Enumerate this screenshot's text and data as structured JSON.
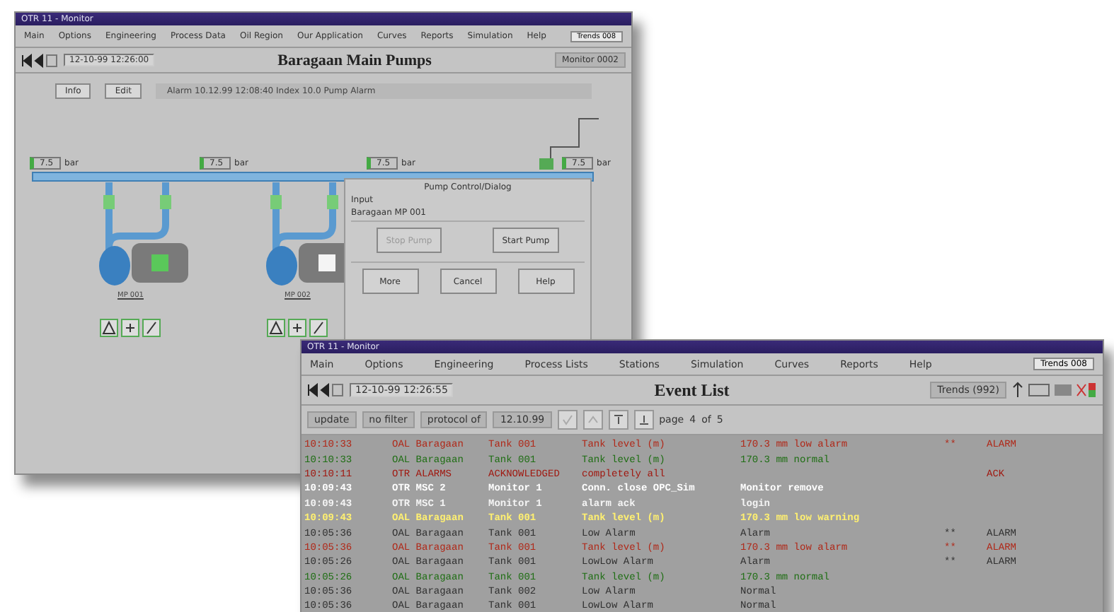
{
  "main_window": {
    "title": "OTR 11 - Monitor",
    "menu": [
      "Main",
      "Options",
      "Engineering",
      "Process Data",
      "Oil Region",
      "Our Application",
      "Curves",
      "Reports",
      "Simulation",
      "Help"
    ],
    "menu_button": "Trends 008",
    "timestamp": "12-10-99 12:26:00",
    "heading": "Baragaan Main Pumps",
    "monitor": "Monitor 0002",
    "status_buttons": [
      "Info",
      "Edit"
    ],
    "status_text": "Alarm 10.12.99 12:08:40 Index 10.0 Pump Alarm",
    "pressure_labels": [
      {
        "value": "7.5",
        "unit": "bar"
      },
      {
        "value": "7.5",
        "unit": "bar"
      },
      {
        "value": "7.5",
        "unit": "bar"
      },
      {
        "value": "7.5",
        "unit": "bar"
      }
    ],
    "pumps": [
      {
        "label": "MP 001",
        "running": true
      },
      {
        "label": "MP 002",
        "running": false
      }
    ],
    "dialog": {
      "title": "Pump Control/Dialog",
      "lines": [
        "Input",
        "Baragaan MP 001"
      ],
      "buttons": [
        {
          "label": "Stop Pump",
          "disabled": true
        },
        {
          "label": "Start Pump",
          "disabled": false
        },
        {
          "label": "More",
          "disabled": false
        },
        {
          "label": "Cancel",
          "disabled": false
        },
        {
          "label": "Help",
          "disabled": false
        }
      ]
    }
  },
  "event_window": {
    "title": "OTR 11 - Monitor",
    "menu": [
      "Main",
      "Options",
      "Engineering",
      "Process Lists",
      "Stations",
      "Simulation",
      "Curves",
      "Reports",
      "Help"
    ],
    "menu_button": "Trends 008",
    "timestamp": "12-10-99 12:26:55",
    "heading": "Event List",
    "trends": "Trends (992)",
    "filters": [
      "update",
      "no filter",
      "protocol of",
      "12.10.99"
    ],
    "page": [
      "page",
      "4",
      "of",
      "5"
    ],
    "rows": [
      {
        "color": "#b02818",
        "cells": [
          "10:10:33",
          "OAL Baragaan",
          "Tank 001",
          "Tank level (m)",
          "170.3 mm low alarm",
          "**",
          "ALARM"
        ]
      },
      {
        "color": "#1f6e14",
        "cells": [
          "10:10:33",
          "OAL Baragaan",
          "Tank 001",
          "Tank level (m)",
          "170.3 mm normal",
          "",
          ""
        ]
      },
      {
        "color": "#a01810",
        "cells": [
          "10:10:11",
          "OTR ALARMS",
          "ACKNOWLEDGED",
          "completely all",
          "",
          "",
          "ACK"
        ]
      },
      {
        "color": "#ffffff",
        "cells": [
          "10:09:43",
          "OTR MSC 2",
          "Monitor 1",
          "Conn. close OPC_Sim",
          "Monitor remove",
          "",
          ""
        ]
      },
      {
        "color": "#f4f4f4",
        "cells": [
          "10:09:43",
          "OTR MSC 1",
          "Monitor 1",
          "alarm ack",
          "login",
          "",
          ""
        ]
      },
      {
        "color": "#fff070",
        "cells": [
          "10:09:43",
          "OAL Baragaan",
          "Tank 001",
          "Tank level (m)",
          "170.3 mm low warning",
          "",
          ""
        ]
      },
      {
        "color": "#303030",
        "cells": [
          "10:05:36",
          "OAL Baragaan",
          "Tank 001",
          "Low Alarm",
          "Alarm",
          "**",
          "ALARM"
        ]
      },
      {
        "color": "#b02818",
        "cells": [
          "10:05:36",
          "OAL Baragaan",
          "Tank 001",
          "Tank level (m)",
          "170.3 mm low alarm",
          "**",
          "ALARM"
        ]
      },
      {
        "color": "#303030",
        "cells": [
          "10:05:26",
          "OAL Baragaan",
          "Tank 001",
          "LowLow Alarm",
          "Alarm",
          "**",
          "ALARM"
        ]
      },
      {
        "color": "#1f6e14",
        "cells": [
          "10:05:26",
          "OAL Baragaan",
          "Tank 001",
          "Tank level (m)",
          "170.3 mm normal",
          "",
          ""
        ]
      },
      {
        "color": "#303030",
        "cells": [
          "10:05:36",
          "OAL Baragaan",
          "Tank 002",
          "Low Alarm",
          "Normal",
          "",
          ""
        ]
      },
      {
        "color": "#303030",
        "cells": [
          "10:05:36",
          "OAL Baragaan",
          "Tank 001",
          "LowLow Alarm",
          "Normal",
          "",
          ""
        ]
      }
    ]
  }
}
